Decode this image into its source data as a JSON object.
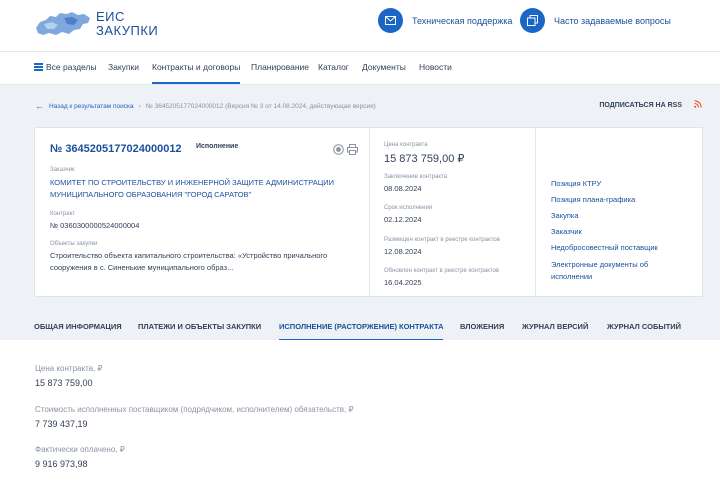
{
  "header": {
    "logo_line1": "ЕИС",
    "logo_line2": "ЗАКУПКИ",
    "support_label": "Техническая поддержка",
    "faq_label": "Часто задаваемые вопросы"
  },
  "nav": {
    "items": [
      "Все разделы",
      "Закупки",
      "Контракты и договоры",
      "Планирование",
      "Каталог",
      "Документы",
      "Новости"
    ],
    "active_index": 2
  },
  "breadcrumb": {
    "back": "Назад к результатам поиска",
    "separator": "›",
    "current": "№ 3645205177024000012 (Версия № 3 от 14.08.2024, действующая версия)"
  },
  "rss_label": "ПОДПИСАТЬСЯ НА RSS",
  "contract": {
    "reg_number": "№ 3645205177024000012",
    "status": "Исполнение",
    "customer_label": "Заказчик",
    "customer_line1": "КОМИТЕТ ПО СТРОИТЕЛЬСТВУ И ИНЖЕНЕРНОЙ ЗАЩИТЕ АДМИНИСТРАЦИИ",
    "customer_line2": "МУНИЦИПАЛЬНОГО ОБРАЗОВАНИЯ \"ГОРОД САРАТОВ\"",
    "contract_label": "Контракт",
    "contract_number": "№ 0360300000524000004",
    "objects_label": "Объекты закупки",
    "objects_line1": "Строительство объекта капитального строительства: «Устройство причального",
    "objects_line2": "сооружения в с. Синенькие муниципального образ..."
  },
  "details": {
    "price_label": "Цена контракта",
    "price_value": "15 873 759,00 ₽",
    "conclusion_label": "Заключение контракта",
    "conclusion_value": "08.08.2024",
    "term_label": "Срок исполнения",
    "term_value": "02.12.2024",
    "placed_label": "Размещен контракт в реестре контрактов",
    "placed_value": "12.08.2024",
    "updated_label": "Обновлен контракт в реестре контрактов",
    "updated_value": "16.04.2025"
  },
  "side_links": [
    "Позиция КТРУ",
    "Позиция плана-графика",
    "Закупка",
    "Заказчик",
    "Недобросовестный поставщик",
    "Электронные документы об",
    "исполнении"
  ],
  "tabs": {
    "items": [
      "ОБЩАЯ ИНФОРМАЦИЯ",
      "ПЛАТЕЖИ И ОБЪЕКТЫ ЗАКУПКИ",
      "ИСПОЛНЕНИЕ (РАСТОРЖЕНИЕ) КОНТРАКТА",
      "ВЛОЖЕНИЯ",
      "ЖУРНАЛ ВЕРСИЙ",
      "ЖУРНАЛ СОБЫТИЙ"
    ],
    "active_index": 2
  },
  "execution": {
    "price_label": "Цена контракта, ₽",
    "price_value": "15 873 759,00",
    "fulfilled_label": "Стоимость исполненных поставщиком (подрядчиком, исполнителем) обязательств, ₽",
    "fulfilled_value": "7 739 437,19",
    "paid_label": "Фактически оплачено, ₽",
    "paid_value": "9 916 973,98"
  },
  "colors": {
    "brand": "#1a4f9c",
    "accent": "#1a66c7",
    "rss": "#e8562a"
  }
}
